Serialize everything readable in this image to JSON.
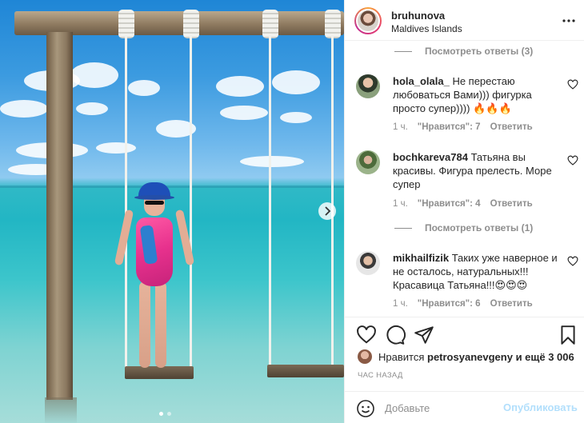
{
  "header": {
    "username": "bruhunova",
    "location": "Maldives Islands"
  },
  "comments": {
    "replies_top": "Посмотреть ответы (3)",
    "items": [
      {
        "username": "hola_olala_",
        "text": "Не перестаю любоваться Вами))) фигурка просто супер)))) 🔥🔥🔥",
        "time": "1 ч.",
        "likes": "\"Нравится\": 7",
        "reply": "Ответить"
      },
      {
        "username": "bochkareva784",
        "text": "Татьяна вы красивы. Фигура прелесть. Море супер",
        "time": "1 ч.",
        "likes": "\"Нравится\": 4",
        "reply": "Ответить"
      },
      {
        "username": "mikhailfizik",
        "text": "Таких уже наверное и не осталось, натуральных!!! Красавица Татьяна!!!😍😍😍",
        "time": "1 ч.",
        "likes": "\"Нравится\": 6",
        "reply": "Ответить"
      }
    ],
    "replies_mid": "Посмотреть ответы (1)"
  },
  "likes": {
    "prefix": "Нравится",
    "user": "petrosyanevgeny",
    "suffix": "и ещё 3 006"
  },
  "time_ago": "ЧАС НАЗАД",
  "add_comment": {
    "placeholder": "Добавьте",
    "post_label": "Опубликовать"
  },
  "colors": {
    "accent_disabled": "#b2dffc",
    "muted": "#8e8e8e",
    "text": "#262626"
  }
}
